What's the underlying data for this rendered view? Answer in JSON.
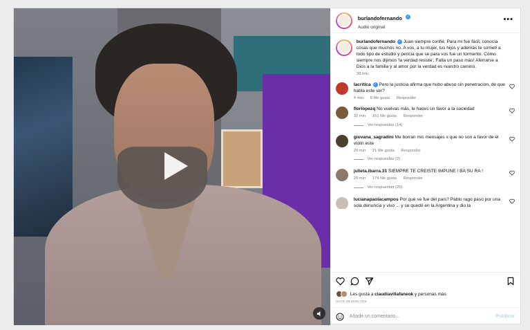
{
  "post": {
    "author": "burlandofernando",
    "audio": "Audio original",
    "more_icon": "more-icon"
  },
  "caption": {
    "author": "burlandofernando",
    "text": "Juan siempre confié. Para mi fue fácil, conocía cosas que muchos no. A vos, a tu mujer, tus hijos y además te sometí a todo tipo de estudio y pericia que se para vos fue un tormento. Cómo siempre nos dijimos 'la verdad resiste'. Falta un paso más! Aferrarse a Dios a la familia y al amor por la verdad es nuestro camino.",
    "time": "38 min"
  },
  "comments": [
    {
      "user": "lacritica",
      "verified": true,
      "text": "Pero la justicia afirma que hubo abuso sin penetracion, de que habla este ser?",
      "time": "4 min",
      "likes": "8 Me gusta",
      "reply": "Responder",
      "replies": "",
      "color": "#c0392b"
    },
    {
      "user": "florlopezq",
      "verified": false,
      "text": "No vuelvas más, le haces un favor a la sociedad",
      "time": "32 min",
      "likes": "151 Me gusta",
      "reply": "Responder",
      "replies": "Ver respuestas (14)",
      "color": "#7a5a3c"
    },
    {
      "user": "giovana_sagradini",
      "verified": false,
      "text": "Me borran mis mensajes x que no son a favor de el violin este",
      "time": "29 min",
      "likes": "21 Me gusta",
      "reply": "Responder",
      "replies": "Ver respuestas (2)",
      "color": "#4a4030"
    },
    {
      "user": "julieta.ibarra.31",
      "verified": false,
      "text": "SIEMPRE TE CREISTE IMPUNE ! BA SU RA !",
      "time": "29 min",
      "likes": "174 Me gusta",
      "reply": "Responder",
      "replies": "Ver respuestas (25)",
      "color": "#8a7a6a"
    },
    {
      "user": "lucianapaolacampos",
      "verified": false,
      "text": "Por qué se fue del país? Pablo rago paso por una sola denuncia y vivo ... y se quedó en la Argentina y dio la",
      "time": "",
      "likes": "",
      "reply": "",
      "replies": "",
      "color": "#c9bfb4"
    }
  ],
  "likes_line": {
    "prefix": "Les gusta a ",
    "user": "claudiavillafaneok",
    "suffix": " y personas más"
  },
  "date": "HACE 38 MINUTOS",
  "add_comment": {
    "placeholder": "Añade un comentario...",
    "post_label": "Publicar"
  },
  "icons": [
    "play-icon",
    "audio-icon",
    "heart-icon",
    "comment-icon",
    "share-icon",
    "bookmark-icon",
    "emoji-icon"
  ]
}
